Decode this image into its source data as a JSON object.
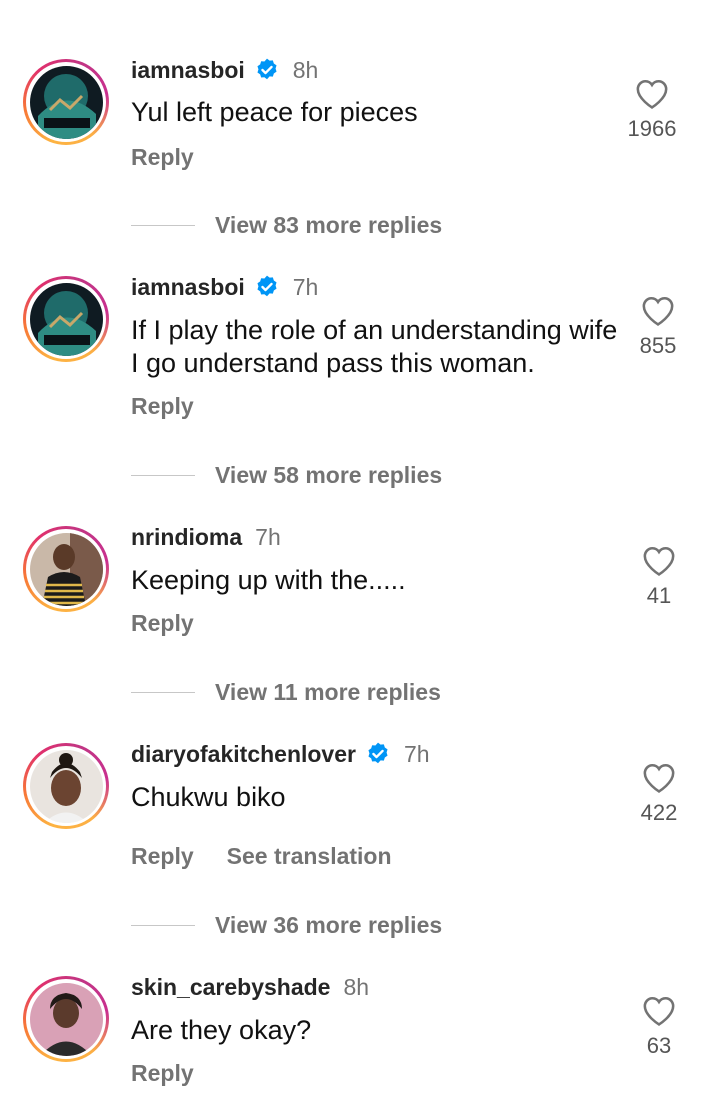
{
  "comments": [
    {
      "username": "iamnasboi",
      "verified": true,
      "time": "8h",
      "text": "Yul left peace for pieces",
      "reply": "Reply",
      "likes": "1966",
      "view_more": "View 83 more replies"
    },
    {
      "username": "iamnasboi",
      "verified": true,
      "time": "7h",
      "text": "If I play the role of an understanding wife I go understand pass this woman.",
      "reply": "Reply",
      "likes": "855",
      "view_more": "View 58 more replies"
    },
    {
      "username": "nrindioma",
      "verified": false,
      "time": "7h",
      "text": "Keeping up with the.....",
      "reply": "Reply",
      "likes": "41",
      "view_more": "View 11 more replies"
    },
    {
      "username": "diaryofakitchenlover",
      "verified": true,
      "time": "7h",
      "text": "Chukwu biko",
      "reply": "Reply",
      "translate": "See translation",
      "likes": "422",
      "view_more": "View 36 more replies"
    },
    {
      "username": "skin_carebyshade",
      "verified": false,
      "time": "8h",
      "text": "Are they okay?",
      "reply": "Reply",
      "likes": "63"
    }
  ],
  "colors": {
    "verified": "#0095f6",
    "muted": "#737373"
  },
  "icons": {
    "like": "heart-outline-icon",
    "verified": "verified-badge-icon"
  }
}
